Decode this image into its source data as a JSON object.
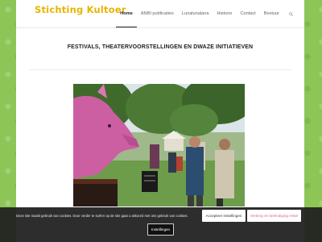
{
  "header": {
    "logo_text": "Stichting Kultoer",
    "nav": [
      {
        "label": "Home",
        "active": true
      },
      {
        "label": "ANBI publicaties",
        "active": false
      },
      {
        "label": "Lunalunalana",
        "active": false
      },
      {
        "label": "Historie",
        "active": false
      },
      {
        "label": "Contact",
        "active": false
      },
      {
        "label": "Bestuur",
        "active": false
      }
    ],
    "search_icon": "search-icon"
  },
  "main": {
    "headline": "FESTIVALS, THEATERVOORSTELLINGEN EN DWAZE INITIATIEVEN",
    "photo_alt": "festival-photo"
  },
  "cookie_bar": {
    "text": "Deze site maakt gebruik van cookies. Door verder te surfen op de site gaat u akkoord met ons gebruik van cookies.",
    "accept_label": "Accepteer instellingen",
    "reject_label": "Verberg en beëindiging enkel",
    "settings_label": "Instellingen"
  },
  "colors": {
    "background_green": "#8dc657",
    "logo_yellow": "#e8b400",
    "reject_pink": "#d96a8f"
  }
}
